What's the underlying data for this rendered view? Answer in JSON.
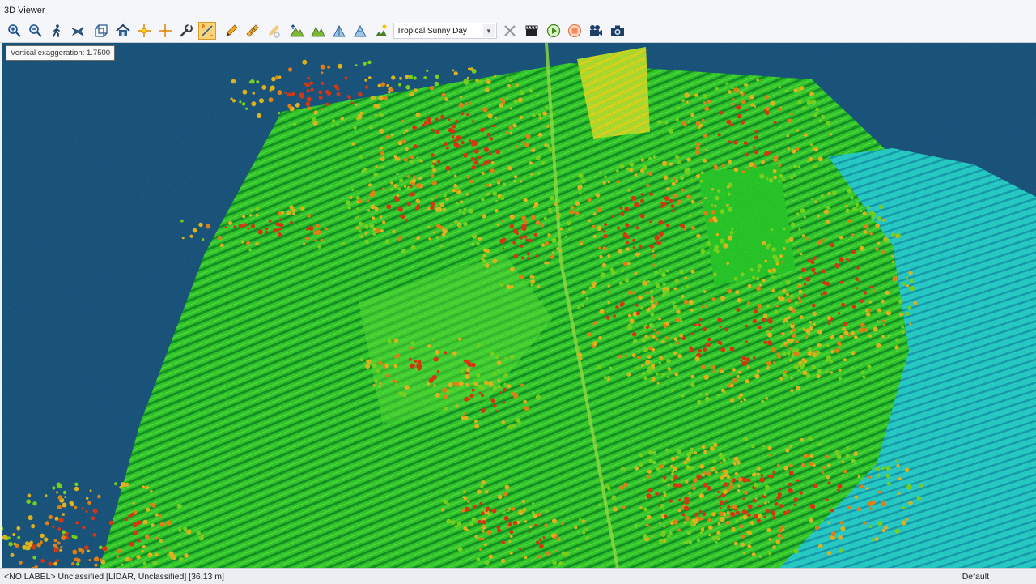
{
  "window": {
    "title": "3D Viewer"
  },
  "toolbar": {
    "tools": [
      {
        "name": "zoom-in-icon"
      },
      {
        "name": "zoom-out-icon"
      },
      {
        "name": "walk-icon"
      },
      {
        "name": "fly-icon"
      },
      {
        "name": "bounding-box-icon"
      },
      {
        "name": "home-icon"
      },
      {
        "name": "pick-point-icon"
      },
      {
        "name": "crosshair-icon"
      },
      {
        "name": "wrench-icon"
      },
      {
        "name": "vertical-exaggeration-icon",
        "active": true
      },
      {
        "name": "pencil-icon"
      },
      {
        "name": "ruler-icon"
      },
      {
        "name": "path-icon"
      },
      {
        "name": "terrain-raise-icon"
      },
      {
        "name": "terrain-icon"
      },
      {
        "name": "elevation-profile-icon"
      },
      {
        "name": "elevation-profile-2-icon"
      }
    ],
    "sky_select": {
      "value": "Tropical Sunny Day"
    },
    "right_tools": [
      {
        "name": "clear-icon"
      },
      {
        "name": "clapperboard-icon"
      },
      {
        "name": "play-icon"
      },
      {
        "name": "stop-icon"
      },
      {
        "name": "video-camera-icon"
      },
      {
        "name": "camera-icon"
      }
    ]
  },
  "viewport": {
    "exaggeration_label": "Vertical exaggeration: 1.7500",
    "colors": {
      "background": "#1c5a84",
      "ground": "#2ed02a",
      "low_veg": "#7ee020",
      "canopy_mid": "#f0c020",
      "canopy_high": "#e83a12",
      "water": "#28d8d0"
    }
  },
  "status": {
    "point_info": "<NO LABEL> Unclassified [LIDAR, Unclassified] [36.13 m]",
    "profile": "Default"
  }
}
